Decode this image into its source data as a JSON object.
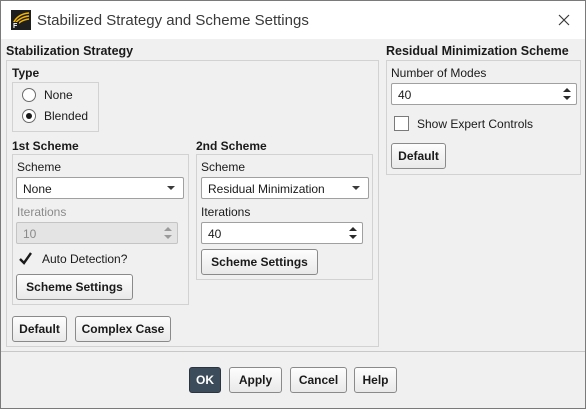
{
  "window": {
    "title": "Stabilized Strategy and Scheme Settings",
    "app_icon": "fluent-app-icon",
    "close_icon": "close-icon"
  },
  "stabilization": {
    "title": "Stabilization Strategy",
    "type": {
      "label": "Type",
      "options": [
        "None",
        "Blended"
      ],
      "selected": "Blended"
    },
    "first_scheme": {
      "title": "1st Scheme",
      "scheme_label": "Scheme",
      "scheme_value": "None",
      "iterations_label": "Iterations",
      "iterations_value": "10",
      "iterations_enabled": false,
      "auto_detection_label": "Auto Detection?",
      "auto_detection_checked": true,
      "settings_button": "Scheme Settings"
    },
    "second_scheme": {
      "title": "2nd Scheme",
      "scheme_label": "Scheme",
      "scheme_value": "Residual Minimization",
      "iterations_label": "Iterations",
      "iterations_value": "40",
      "settings_button": "Scheme Settings"
    },
    "default_button": "Default",
    "complex_case_button": "Complex Case"
  },
  "residual_min": {
    "title": "Residual Minimization Scheme",
    "modes_label": "Number of Modes",
    "modes_value": "40",
    "expert_label": "Show Expert Controls",
    "expert_checked": false,
    "default_button": "Default"
  },
  "footer": {
    "ok": "OK",
    "apply": "Apply",
    "cancel": "Cancel",
    "help": "Help"
  },
  "colors": {
    "ok_button": "#3c4c5a",
    "window_bg": "#f0f0f0",
    "titlebar_bg": "#ffffff"
  }
}
